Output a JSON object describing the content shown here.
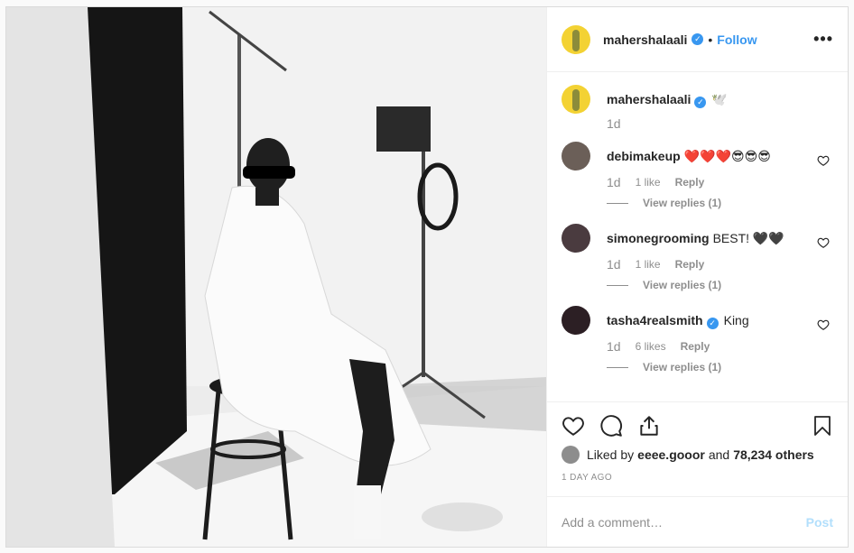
{
  "post": {
    "author": "mahershalaali",
    "follow_label": "Follow",
    "dot": "•",
    "more_icon": "more-horizontal-icon",
    "caption_text": "🕊️",
    "caption_age": "1d"
  },
  "comments": [
    {
      "user": "debimakeup",
      "text": "❤️❤️❤️😎😎😎",
      "age": "1d",
      "likes": "1 like",
      "reply": "Reply",
      "view_replies": "View replies (1)",
      "avatar_color": "#6b5f58"
    },
    {
      "user": "simonegrooming",
      "text": "BEST! 🖤🖤",
      "age": "1d",
      "likes": "1 like",
      "reply": "Reply",
      "view_replies": "View replies (1)",
      "avatar_color": "#4a3b3f"
    },
    {
      "user": "tasha4realsmith",
      "text": "King",
      "age": "1d",
      "likes": "6 likes",
      "reply": "Reply",
      "view_replies": "View replies (1)",
      "avatar_color": "#2c1f24"
    }
  ],
  "actions": {
    "like_icon": "heart-icon",
    "comment_icon": "comment-icon",
    "share_icon": "share-icon",
    "save_icon": "bookmark-icon"
  },
  "likes": {
    "prefix": "Liked by ",
    "first_user": "eeee.gooor",
    "middle": " and ",
    "others": "78,234 others"
  },
  "timestamp": "1 DAY AGO",
  "add_comment": {
    "placeholder": "Add a comment…",
    "post_label": "Post"
  },
  "colors": {
    "accent": "#3897f0",
    "avatar_yellow": "#f3d233"
  }
}
